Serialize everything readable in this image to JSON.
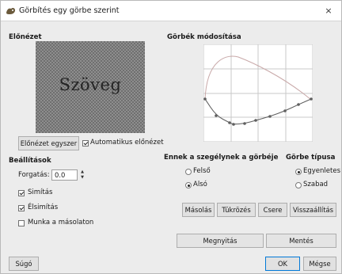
{
  "window": {
    "title": "Görbítés egy görbe szerint",
    "close_glyph": "×"
  },
  "preview": {
    "heading": "Előnézet",
    "sample_text": "Szöveg"
  },
  "preview_once_button": "Előnézet egyszer",
  "auto_preview": {
    "label": "Automatikus előnézet",
    "checked": true
  },
  "settings": {
    "heading": "Beállítások",
    "rotation_label": "Forgatás:",
    "rotation_value": "0.0",
    "smoothing": {
      "label": "Simítás",
      "checked": true
    },
    "antialias": {
      "label": "Élsimítás",
      "checked": true
    },
    "work_on_copy": {
      "label": "Munka a másolaton",
      "checked": false
    }
  },
  "curves": {
    "heading": "Görbék módosítása",
    "edge_heading": "Ennek a szegélynek a görbéje",
    "upper_label": "Felső",
    "lower_label": "Alsó",
    "selected_edge": "Alsó",
    "type_heading": "Görbe típusa",
    "smooth_label": "Egyenletes",
    "free_label": "Szabad",
    "selected_type": "Egyenletes"
  },
  "buttons": {
    "copy": "Másolás",
    "mirror": "Tükrözés",
    "swap": "Csere",
    "reset": "Visszaállítás",
    "open": "Megnyitás",
    "save": "Mentés",
    "help": "Súgó",
    "ok": "OK",
    "cancel": "Mégse"
  },
  "colors": {
    "curve_active": "#5f5f5f",
    "curve_inactive": "#c8a8a8",
    "grid": "#c8c8c8"
  }
}
